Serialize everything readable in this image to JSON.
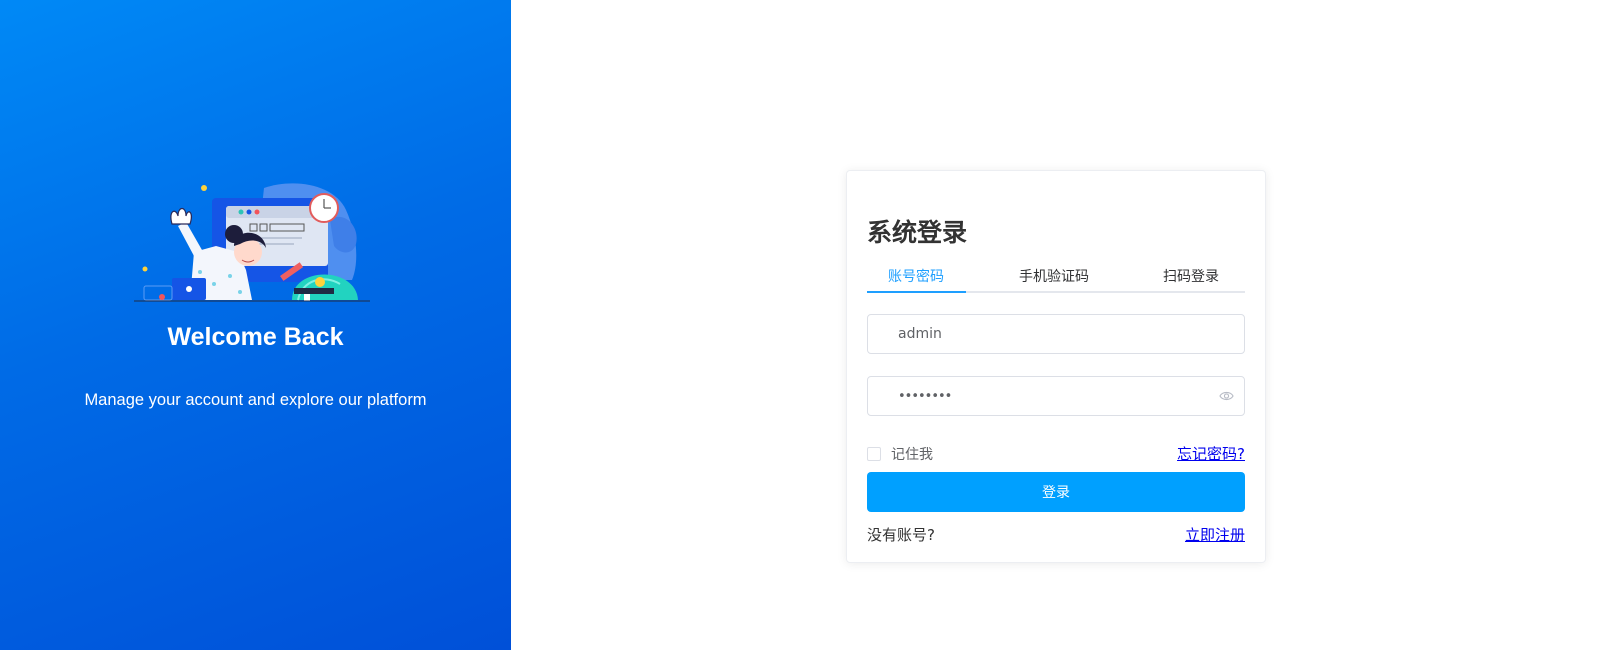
{
  "hero": {
    "title": "Welcome Back",
    "subtitle": "Manage your account and explore our platform",
    "illustration_icon": "person-waving-at-computer-illustration"
  },
  "login": {
    "title": "系统登录",
    "tabs": [
      {
        "label": "账号密码",
        "active": true
      },
      {
        "label": "手机验证码",
        "active": false
      },
      {
        "label": "扫码登录",
        "active": false
      }
    ],
    "username": {
      "value": "admin",
      "placeholder": ""
    },
    "password": {
      "value": "••••••••",
      "placeholder": "",
      "toggle_icon": "eye-icon"
    },
    "remember_label": "记住我",
    "remember_checked": false,
    "forgot_label": "忘记密码?",
    "submit_label": "登录",
    "no_account_label": "没有账号?",
    "register_label": "立即注册"
  },
  "colors": {
    "hero_gradient_start": "#0089f6",
    "hero_gradient_end": "#0050d8",
    "primary": "#00a0ff",
    "tab_active": "#1e9fff",
    "link": "#0000ee"
  }
}
